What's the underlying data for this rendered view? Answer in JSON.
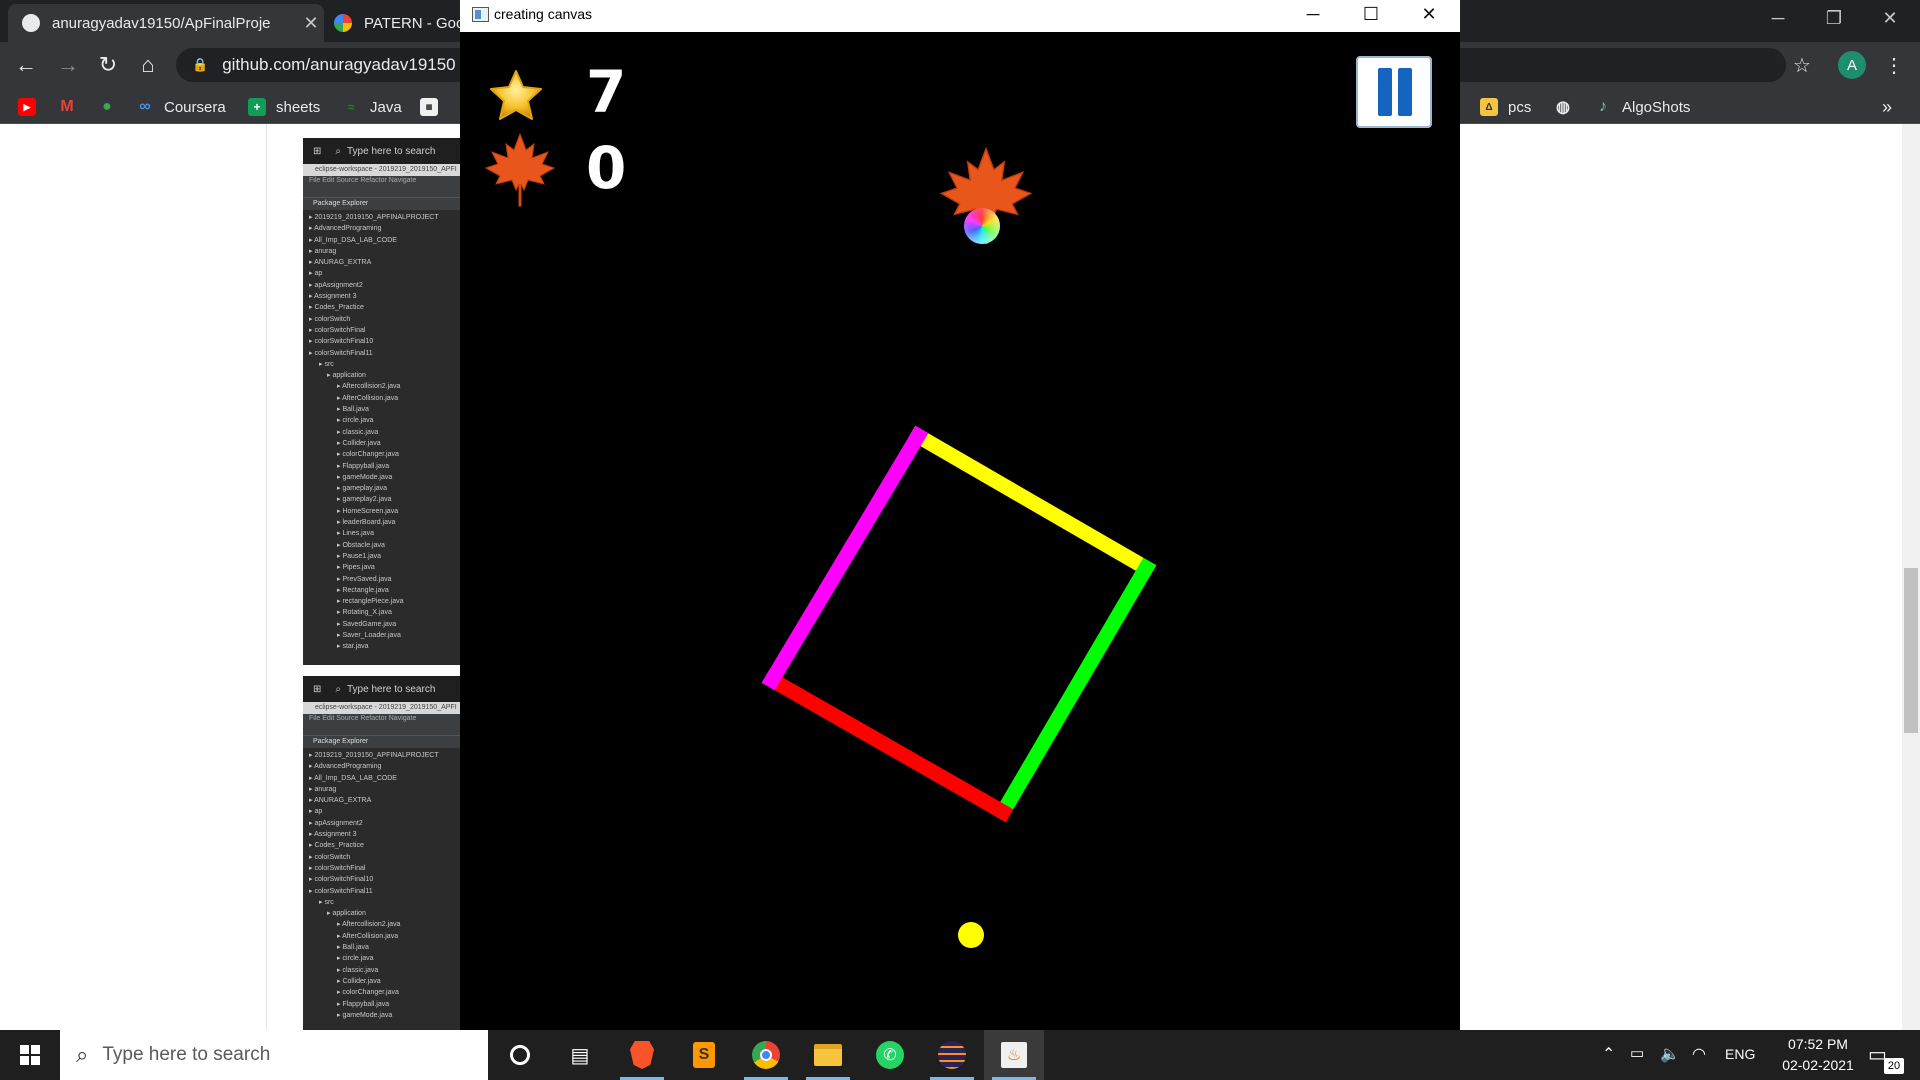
{
  "browser": {
    "tabs": [
      {
        "label": "anuragyadav19150/ApFinalProje",
        "icon": "github-icon",
        "active": true
      },
      {
        "label": "PATERN - Googl",
        "icon": "google-icon",
        "active": false
      }
    ],
    "address": "github.com/anuragyadav19150",
    "profile_initial": "A",
    "bookmarks": [
      {
        "label": "",
        "icon": "youtube-icon",
        "color": "#ff0000"
      },
      {
        "label": "",
        "icon": "gmail-icon",
        "color": "#ea4335"
      },
      {
        "label": "",
        "icon": "maps-icon",
        "color": "#34a853"
      },
      {
        "label": "Coursera",
        "icon": "coursera-icon",
        "color": "#1a73e8"
      },
      {
        "label": "sheets",
        "icon": "sheets-icon",
        "color": "#0f9d58"
      },
      {
        "label": "Java",
        "icon": "java-icon",
        "color": "#2e7d32"
      },
      {
        "label": "",
        "icon": "backpack-icon",
        "color": "#f0f0f0"
      }
    ],
    "bookmarks_right": [
      {
        "label": "pcs",
        "icon": "pcs-icon",
        "color": "#f4c542"
      },
      {
        "label": "",
        "icon": "globe-icon",
        "color": "#e8eaed"
      },
      {
        "label": "AlgoShots",
        "icon": "algoshots-icon",
        "color": "#7ec8a0"
      }
    ],
    "overflow_label": "»"
  },
  "thumbnails": {
    "taskbar_search": "Type here to search",
    "eclipse_title": "eclipse-workspace - 2019219_2019150_APFI",
    "menu": "File   Edit   Source   Refactor   Navigate",
    "panel_title": "Package Explorer",
    "tree_top": [
      "2019219_2019150_APFINALPROJECT",
      "AdvancedPrograming",
      "All_Imp_DSA_LAB_CODE",
      "anurag",
      "ANURAG_EXTRA",
      "ap",
      "apAssignment2",
      "Assignment 3",
      "Codes_Practice",
      "colorSwitch",
      "colorSwitchFinal",
      "colorSwitchFinal10",
      "colorSwitchFinal11",
      "src",
      "application",
      "Aftercollision2.java",
      "AfterCollision.java",
      "Ball.java",
      "circle.java",
      "classic.java",
      "Collider.java",
      "colorChanger.java",
      "Flappyball.java",
      "gameMode.java",
      "gameplay.java",
      "gameplay2.java",
      "HomeScreen.java",
      "leaderBoard.java",
      "Lines.java",
      "Obstacle.java",
      "Pause1.java",
      "Pipes.java",
      "PrevSaved.java",
      "Rectangle.java",
      "rectanglePiece.java",
      "Rotating_X.java",
      "SavedGame.java",
      "Saver_Loader.java",
      "star.java"
    ],
    "tree_bottom": [
      "2019219_2019150_APFINALPROJECT",
      "AdvancedPrograming",
      "All_Imp_DSA_LAB_CODE",
      "anurag",
      "ANURAG_EXTRA",
      "ap",
      "apAssignment2",
      "Assignment 3",
      "Codes_Practice",
      "colorSwitch",
      "colorSwitchFinal",
      "colorSwitchFinal10",
      "colorSwitchFinal11",
      "src",
      "application",
      "Aftercollision2.java",
      "AfterCollision.java",
      "Ball.java",
      "circle.java",
      "classic.java",
      "Collider.java",
      "colorChanger.java",
      "Flappyball.java",
      "gameMode.java"
    ]
  },
  "game_window": {
    "title": "creating canvas",
    "stars_count": "7",
    "lives_count": "0",
    "colors": {
      "square_top": "#ffff00",
      "square_right": "#00ff00",
      "square_bottom": "#ff0000",
      "square_left": "#ff00ff",
      "ball": "#ffff00"
    }
  },
  "taskbar": {
    "search_placeholder": "Type here to search",
    "apps": [
      "cortana-icon",
      "task-view-icon",
      "brave-icon",
      "sublime-icon",
      "chrome-icon",
      "file-explorer-icon",
      "whatsapp-icon",
      "eclipse-icon",
      "java-icon"
    ],
    "language": "ENG",
    "time": "07:52 PM",
    "date": "02-02-2021",
    "notification_count": "20"
  }
}
